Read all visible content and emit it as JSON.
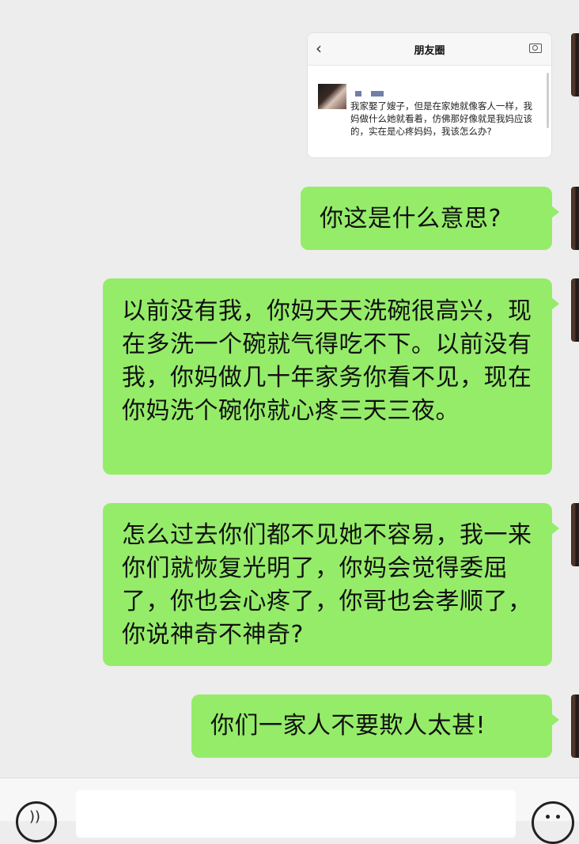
{
  "screenshot_post": {
    "back_icon": "chevron-left-icon",
    "title": "朋友圈",
    "camera_icon": "camera-icon",
    "text": "我家娶了嫂子，但是在家她就像客人一样，我妈做什么她就看着，仿佛那好像就是我妈应该的，实在是心疼妈妈，我该怎么办?"
  },
  "messages": [
    {
      "text": "你这是什么意思?"
    },
    {
      "text": "以前没有我，你妈天天洗碗很高兴，现在多洗一个碗就气得吃不下。以前没有我，你妈做几十年家务你看不见，现在你妈洗个碗你就心疼三天三夜。"
    },
    {
      "text": "怎么过去你们都不见她不容易，我一来你们就恢复光明了，你妈会觉得委屈了，你也会心疼了，你哥也会孝顺了，你说神奇不神奇?"
    },
    {
      "text": "你们一家人不要欺人太甚!"
    }
  ],
  "input_bar": {
    "voice_icon": "voice-icon",
    "emoji_icon": "emoji-icon",
    "input_value": ""
  },
  "colors": {
    "bubble": "#95ec69",
    "background": "#ededed"
  }
}
